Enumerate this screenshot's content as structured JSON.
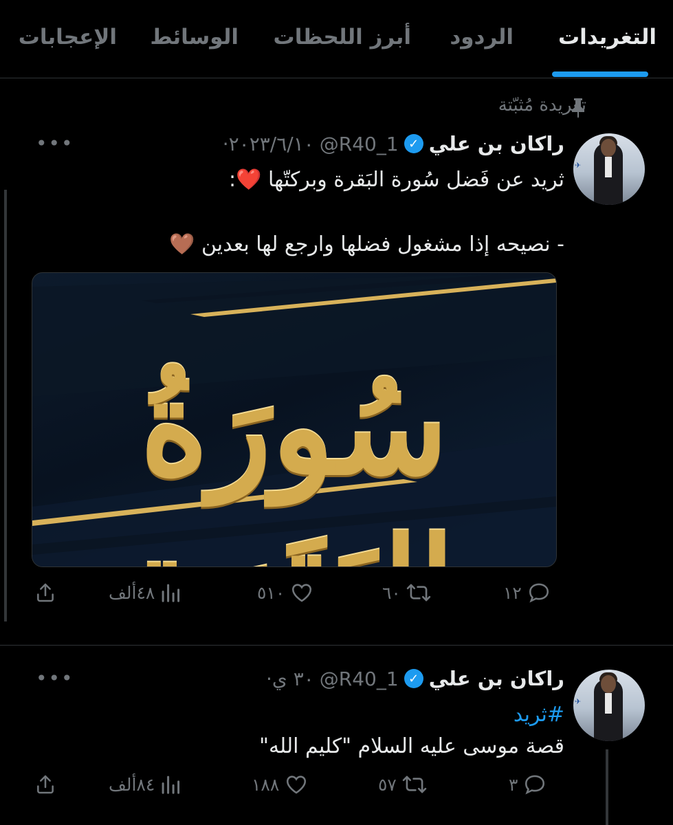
{
  "tabs": [
    {
      "label": "التغريدات",
      "active": true
    },
    {
      "label": "الردود",
      "active": false
    },
    {
      "label": "أبرز اللحظات",
      "active": false
    },
    {
      "label": "الوسائط",
      "active": false
    },
    {
      "label": "الإعجابات",
      "active": false
    }
  ],
  "accent_color": "#1d9bf0",
  "pinned_label": "تغريدة مُثبّتة",
  "tweets": [
    {
      "name": "راكان بن علي",
      "handle": "@R40_1",
      "time": "·٢٠٢٣/٦/١٠",
      "text_line1": "ثريد عن فَضل سُورة البَقرة وبركتّها ❤️:",
      "text_line2": "- نصيحه إذا مشغول فضلها وارجع لها بعدين 🤎",
      "media_title": "سُورَةُ البَقَرَة",
      "replies": "١٢",
      "retweets": "٦٠",
      "likes": "٥١٠",
      "views": "٤٨ألف"
    },
    {
      "name": "راكان بن علي",
      "handle": "@R40_1",
      "time": "·٣٠ ي",
      "hashtag": "#ثريد",
      "text_line1": "قصة موسى عليه السلام \"كليم الله\"",
      "replies": "٣",
      "retweets": "٥٧",
      "likes": "١٨٨",
      "views": "٨٤ألف"
    }
  ],
  "icons": {
    "pin": "pin-icon",
    "verified": "verified-badge-icon",
    "more": "more-icon",
    "reply": "reply-icon",
    "retweet": "retweet-icon",
    "like": "heart-icon",
    "views": "views-icon",
    "share": "share-icon"
  }
}
